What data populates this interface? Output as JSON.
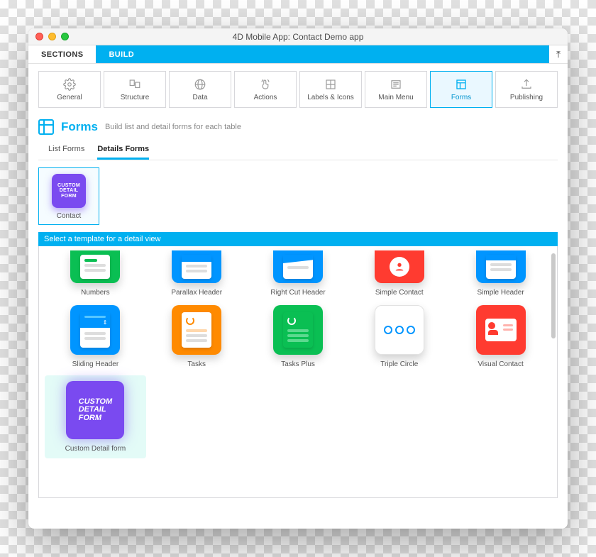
{
  "window": {
    "title": "4D Mobile App: Contact Demo app"
  },
  "tabs": {
    "sections": "SECTIONS",
    "build": "BUILD"
  },
  "nav": [
    {
      "id": "general",
      "label": "General"
    },
    {
      "id": "structure",
      "label": "Structure"
    },
    {
      "id": "data",
      "label": "Data"
    },
    {
      "id": "actions",
      "label": "Actions"
    },
    {
      "id": "labels",
      "label": "Labels & Icons"
    },
    {
      "id": "mainmenu",
      "label": "Main Menu"
    },
    {
      "id": "forms",
      "label": "Forms",
      "active": true
    },
    {
      "id": "publishing",
      "label": "Publishing"
    }
  ],
  "page": {
    "title": "Forms",
    "subtitle": "Build list and detail forms for each table"
  },
  "subtabs": {
    "list": "List Forms",
    "details": "Details Forms"
  },
  "tables": {
    "selected": {
      "name": "Contact",
      "thumbText": "CUSTOM\nDETAIL\nFORM"
    }
  },
  "templateBanner": "Select a template for a detail view",
  "templatesRow1": [
    {
      "id": "numbers",
      "label": "Numbers",
      "color": "green"
    },
    {
      "id": "parallax",
      "label": "Parallax Header",
      "color": "blue"
    },
    {
      "id": "rightcut",
      "label": "Right Cut Header",
      "color": "blue"
    },
    {
      "id": "simplecontact",
      "label": "Simple Contact",
      "color": "red"
    },
    {
      "id": "simpleheader",
      "label": "Simple Header",
      "color": "blue"
    }
  ],
  "templatesRow2": [
    {
      "id": "sliding",
      "label": "Sliding Header",
      "color": "blue"
    },
    {
      "id": "tasks",
      "label": "Tasks",
      "color": "orange"
    },
    {
      "id": "tasksplus",
      "label": "Tasks Plus",
      "color": "green"
    },
    {
      "id": "triple",
      "label": "Triple Circle",
      "color": "white"
    },
    {
      "id": "visual",
      "label": "Visual Contact",
      "color": "red"
    }
  ],
  "templatesRow3": [
    {
      "id": "customdetail",
      "label": "Custom Detail form",
      "color": "purple",
      "selected": true,
      "thumbText": "CUSTOM\nDETAIL\nFORM"
    }
  ]
}
